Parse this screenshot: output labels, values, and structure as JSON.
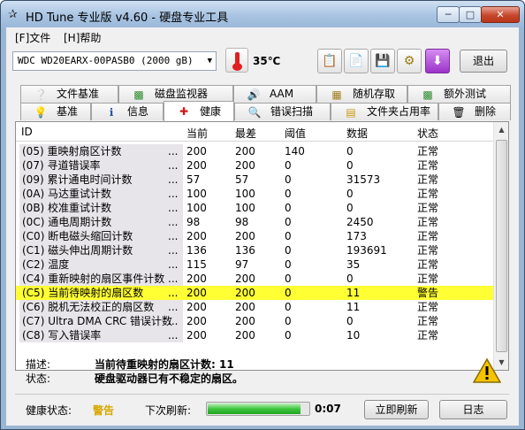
{
  "window": {
    "title": "HD Tune 专业版 v4.60 - 硬盘专业工具",
    "min_label": "─",
    "max_label": "□",
    "close_label": "✕"
  },
  "menu": {
    "file": "[F]文件",
    "help": "[H]帮助"
  },
  "toolbar": {
    "drive": "WDC WD20EARX-00PASB0 (2000 gB)",
    "temperature": "35℃",
    "exit_label": "退出",
    "icons": [
      "copy-text-icon",
      "copy-screen-icon",
      "save-icon",
      "settings-icon",
      "download-icon"
    ]
  },
  "tabs_row1": [
    {
      "label": "文件基准",
      "icon": "info-icon"
    },
    {
      "label": "磁盘监视器",
      "icon": "chart-icon"
    },
    {
      "label": "AAM",
      "icon": "speaker-icon"
    },
    {
      "label": "随机存取",
      "icon": "random-access-icon"
    },
    {
      "label": "额外测试",
      "icon": "extra-tests-icon"
    }
  ],
  "tabs_row2": [
    {
      "label": "基准",
      "icon": "lightbulb-icon"
    },
    {
      "label": "信息",
      "icon": "info-icon"
    },
    {
      "label": "健康",
      "icon": "health-cross-icon"
    },
    {
      "label": "错误扫描",
      "icon": "magnifier-icon"
    },
    {
      "label": "文件夹占用率",
      "icon": "folder-icon"
    },
    {
      "label": "删除",
      "icon": "trash-icon"
    }
  ],
  "columns": [
    "ID",
    "当前",
    "最差",
    "阈值",
    "数据",
    "状态"
  ],
  "rows": [
    {
      "id": "(05) 重映射扇区计数",
      "current": "200",
      "worst": "200",
      "threshold": "140",
      "data": "0",
      "status": "正常"
    },
    {
      "id": "(07) 寻道错误率",
      "current": "200",
      "worst": "200",
      "threshold": "0",
      "data": "0",
      "status": "正常"
    },
    {
      "id": "(09) 累计通电时间计数",
      "current": "57",
      "worst": "57",
      "threshold": "0",
      "data": "31573",
      "status": "正常"
    },
    {
      "id": "(0A) 马达重试计数",
      "current": "100",
      "worst": "100",
      "threshold": "0",
      "data": "0",
      "status": "正常"
    },
    {
      "id": "(0B) 校准重试计数",
      "current": "100",
      "worst": "100",
      "threshold": "0",
      "data": "0",
      "status": "正常"
    },
    {
      "id": "(0C) 通电周期计数",
      "current": "98",
      "worst": "98",
      "threshold": "0",
      "data": "2450",
      "status": "正常"
    },
    {
      "id": "(C0) 断电磁头缩回计数",
      "current": "200",
      "worst": "200",
      "threshold": "0",
      "data": "173",
      "status": "正常"
    },
    {
      "id": "(C1) 磁头伸出周期计数",
      "current": "136",
      "worst": "136",
      "threshold": "0",
      "data": "193691",
      "status": "正常"
    },
    {
      "id": "(C2) 温度",
      "current": "115",
      "worst": "97",
      "threshold": "0",
      "data": "35",
      "status": "正常"
    },
    {
      "id": "(C4) 重新映射的扇区事件计数",
      "current": "200",
      "worst": "200",
      "threshold": "0",
      "data": "0",
      "status": "正常"
    },
    {
      "id": "(C5) 当前待映射的扇区数",
      "current": "200",
      "worst": "200",
      "threshold": "0",
      "data": "11",
      "status": "警告"
    },
    {
      "id": "(C6) 脱机无法校正的扇区数",
      "current": "200",
      "worst": "200",
      "threshold": "0",
      "data": "11",
      "status": "正常"
    },
    {
      "id": "(C7) Ultra DMA CRC 错误计数",
      "current": "200",
      "worst": "200",
      "threshold": "0",
      "data": "0",
      "status": "正常"
    },
    {
      "id": "(C8) 写入错误率",
      "current": "200",
      "worst": "200",
      "threshold": "0",
      "data": "10",
      "status": "正常"
    }
  ],
  "highlight_color": "#ffff33",
  "dots_text": "...",
  "description": {
    "desc_label": "描述:",
    "desc_value": "当前待重映射的扇区计数: 11",
    "status_label": "状态:",
    "status_value": "硬盘驱动器已有不稳定的扇区。"
  },
  "bottom": {
    "health_label": "健康状态:",
    "health_value": "警告",
    "health_color": "#d8a800",
    "refresh_label": "下次刷新:",
    "progress_fraction": 0.92,
    "timer": "0:07",
    "refresh_button": "立即刷新",
    "log_button": "日志"
  }
}
